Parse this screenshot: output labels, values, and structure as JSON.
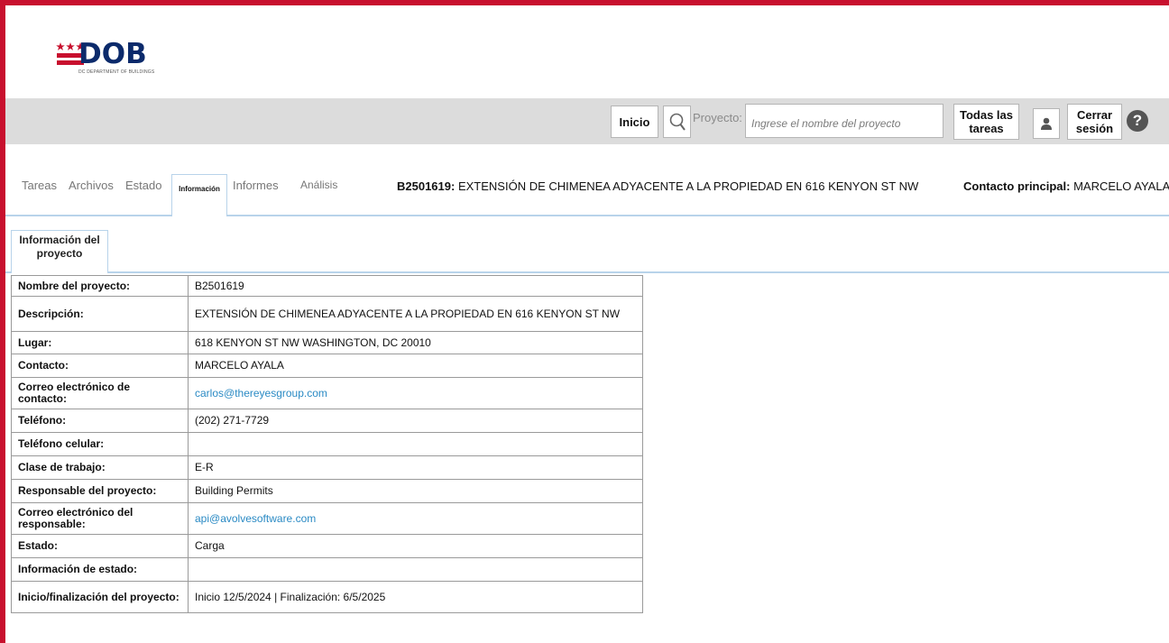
{
  "logo": {
    "word": "DOB",
    "subtitle": "DC DEPARTMENT OF BUILDINGS"
  },
  "colors": {
    "brand_red": "#c8102e",
    "brand_blue": "#0b2a6b",
    "link": "#2a8ac4",
    "tab_border": "#b8d3ea",
    "toolbar_bg": "#dcdcdc"
  },
  "toolbar": {
    "home_label": "Inicio",
    "search_icon": "magnifier-icon",
    "project_label": "Proyecto:",
    "project_placeholder": "Ingrese el nombre del proyecto",
    "all_tasks_label": "Todas las tareas",
    "user_icon": "user-icon",
    "logout_label": "Cerrar sesión",
    "help_icon": "help-icon"
  },
  "nav": {
    "tabs": [
      {
        "label": "Tareas"
      },
      {
        "label": "Archivos"
      },
      {
        "label": "Estado"
      },
      {
        "label": "Información",
        "active": true
      },
      {
        "label": "Informes"
      },
      {
        "label": "Análisis"
      }
    ],
    "project_id": "B2501619:",
    "project_title": "EXTENSIÓN DE CHIMENEA ADYACENTE A LA PROPIEDAD EN 616 KENYON ST NW",
    "contact_label": "Contacto principal:",
    "contact_name": "MARCELO AYALA"
  },
  "subtab": {
    "label": "Información del proyecto"
  },
  "project_info": [
    {
      "label": "Nombre del proyecto:",
      "value": "B2501619"
    },
    {
      "label": "Descripción:",
      "value": "EXTENSIÓN DE CHIMENEA ADYACENTE A LA PROPIEDAD EN 616 KENYON ST NW"
    },
    {
      "label": "Lugar:",
      "value": "618 KENYON ST NW WASHINGTON, DC 20010"
    },
    {
      "label": "Contacto:",
      "value": "MARCELO AYALA"
    },
    {
      "label": "Correo electrónico de contacto:",
      "value": "carlos@thereyesgroup.com",
      "link": true
    },
    {
      "label": "Teléfono:",
      "value": "(202) 271-7729"
    },
    {
      "label": "Teléfono celular:",
      "value": ""
    },
    {
      "label": "Clase de trabajo:",
      "value": "E-R"
    },
    {
      "label": "Responsable del proyecto:",
      "value": "Building Permits"
    },
    {
      "label": "Correo electrónico del responsable:",
      "value": "api@avolvesoftware.com",
      "link": true
    },
    {
      "label": "Estado:",
      "value": "Carga"
    },
    {
      "label": "Información de estado:",
      "value": ""
    },
    {
      "label": "Inicio/finalización del proyecto:",
      "value": "Inicio 12/5/2024 | Finalización: 6/5/2025"
    }
  ]
}
